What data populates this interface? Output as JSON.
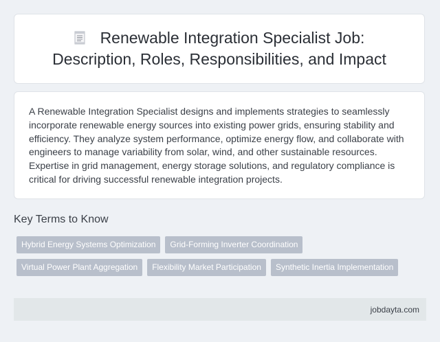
{
  "header": {
    "icon": "document-icon",
    "title_line1": "Renewable Integration Specialist Job:",
    "title_line2": "Description, Roles, Responsibilities, and Impact"
  },
  "description": "A Renewable Integration Specialist designs and implements strategies to seamlessly incorporate renewable energy sources into existing power grids, ensuring stability and efficiency. They analyze system performance, optimize energy flow, and collaborate with engineers to manage variability from solar, wind, and other sustainable resources. Expertise in grid management, energy storage solutions, and regulatory compliance is critical for driving successful renewable integration projects.",
  "key_terms": {
    "heading": "Key Terms to Know",
    "row1": [
      "Hybrid Energy Systems Optimization",
      "Grid-Forming Inverter Coordination"
    ],
    "row2": [
      "Virtual Power Plant Aggregation",
      "Flexibility Market Participation",
      "Synthetic Inertia Implementation"
    ]
  },
  "footer": {
    "site": "jobdayta.com"
  },
  "colors": {
    "page_background": "#eef1f5",
    "card_background": "#ffffff",
    "tag_background": "#b8bfcb",
    "footer_background": "#e2e7e9"
  }
}
